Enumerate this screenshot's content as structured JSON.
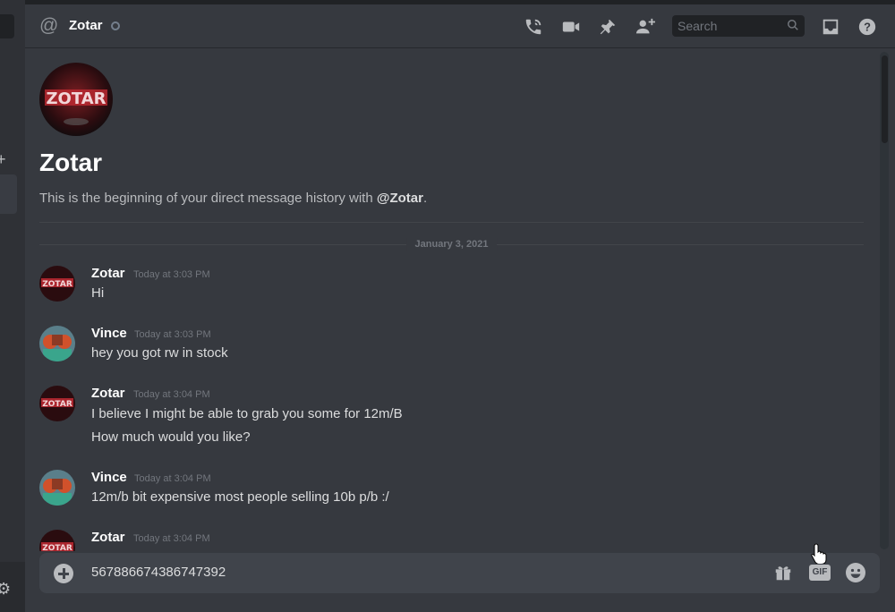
{
  "header": {
    "channel_name": "Zotar",
    "search_placeholder": "Search",
    "icons": [
      "at-icon",
      "status-offline-icon",
      "voice-call-icon",
      "video-call-icon",
      "pin-icon",
      "add-friend-icon",
      "search-icon",
      "inbox-icon",
      "help-icon"
    ]
  },
  "welcome": {
    "title": "Zotar",
    "description_prefix": "This is the beginning of your direct message history with ",
    "description_handle": "@Zotar",
    "description_suffix": "."
  },
  "date_divider": "January 3, 2021",
  "messages": [
    {
      "author": "Zotar",
      "time": "Today at 3:03 PM",
      "lines": [
        "Hi"
      ]
    },
    {
      "author": "Vince",
      "time": "Today at 3:03 PM",
      "lines": [
        "hey you got rw in stock"
      ]
    },
    {
      "author": "Zotar",
      "time": "Today at 3:04 PM",
      "lines": [
        "I believe I might be able to grab you some for 12m/B",
        "How much would you like?"
      ]
    },
    {
      "author": "Vince",
      "time": "Today at 3:04 PM",
      "lines": [
        "12m/b bit expensive most people selling 10b p/b :/"
      ]
    },
    {
      "author": "Zotar",
      "time": "Today at 3:04 PM",
      "lines": []
    }
  ],
  "composer": {
    "value": "567886674386747392",
    "gif_label": "GIF"
  },
  "colors": {
    "background": "#36393f",
    "header_text": "#ffffff",
    "message_text": "#dcddde",
    "timestamp": "#72767d",
    "composer_bg": "#40444b"
  }
}
